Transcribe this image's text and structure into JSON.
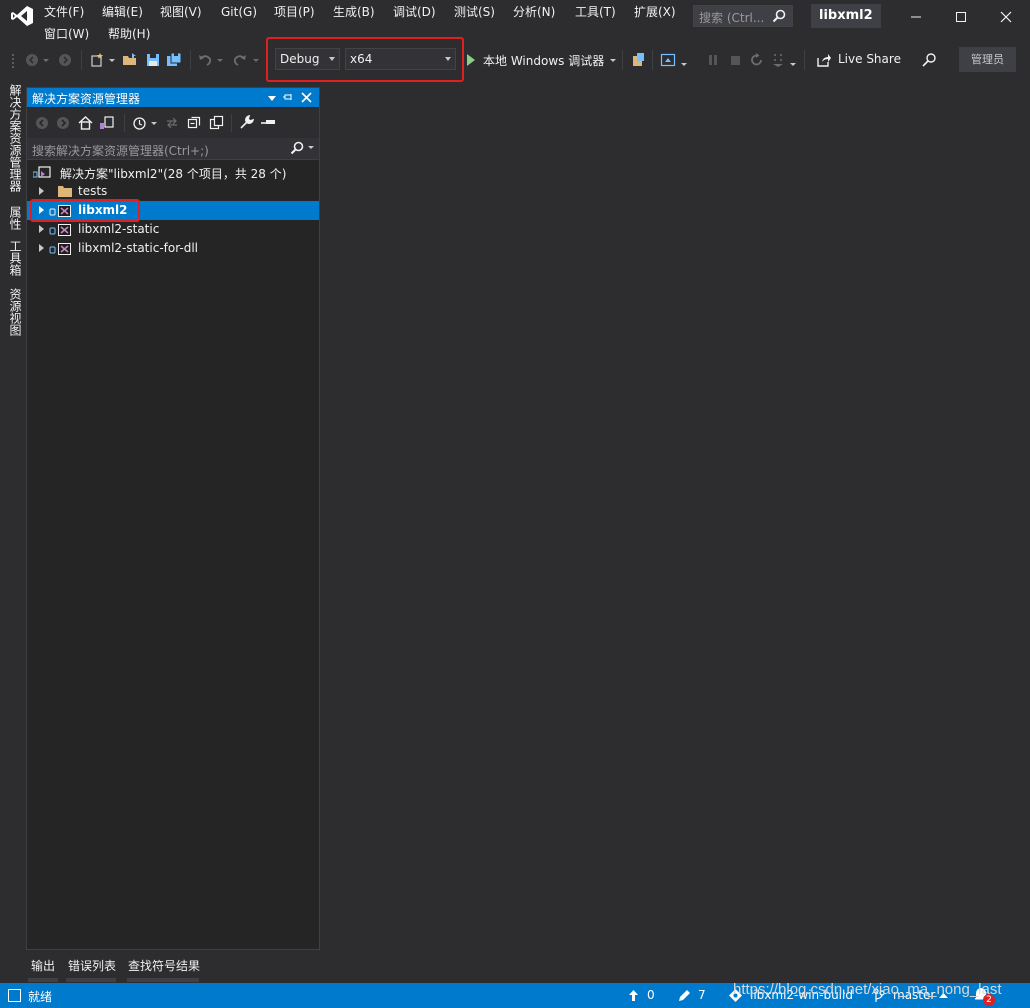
{
  "menu": {
    "row1": [
      "文件(F)",
      "编辑(E)",
      "视图(V)",
      "Git(G)",
      "项目(P)",
      "生成(B)",
      "调试(D)",
      "测试(S)",
      "分析(N)",
      "工具(T)",
      "扩展(X)"
    ],
    "row2": [
      "窗口(W)",
      "帮助(H)"
    ]
  },
  "search": {
    "placeholder": "搜索 (Ctrl..."
  },
  "window": {
    "solution_name": "libxml2"
  },
  "toolbar": {
    "configuration": "Debug",
    "platform": "x64",
    "start_debug_label": "本地 Windows 调试器",
    "live_share_label": "Live Share",
    "admin_label": "管理员"
  },
  "side_tabs": [
    "解决方案资源管理器",
    "属性",
    "工具箱",
    "资源视图"
  ],
  "solution_explorer": {
    "title": "解决方案资源管理器",
    "search_placeholder": "搜索解决方案资源管理器(Ctrl+;)",
    "root": "解决方案\"libxml2\"(28 个项目，共 28 个)",
    "items": [
      {
        "label": "tests",
        "kind": "folder"
      },
      {
        "label": "libxml2",
        "kind": "project",
        "selected": true
      },
      {
        "label": "libxml2-static",
        "kind": "project"
      },
      {
        "label": "libxml2-static-for-dll",
        "kind": "project"
      }
    ]
  },
  "bottom_tabs": [
    "输出",
    "错误列表",
    "查找符号结果"
  ],
  "status": {
    "ready": "就绪",
    "push_count": "0",
    "changes_count": "7",
    "repo": "libxml2-win-build",
    "branch": "master",
    "notifications": "2"
  },
  "watermark": "https://blog.csdn.net/xiao_ma_nong_last",
  "colors": {
    "accent": "#007acc",
    "highlight_box": "#e02020",
    "background": "#2d2d30",
    "panel": "#252526"
  }
}
